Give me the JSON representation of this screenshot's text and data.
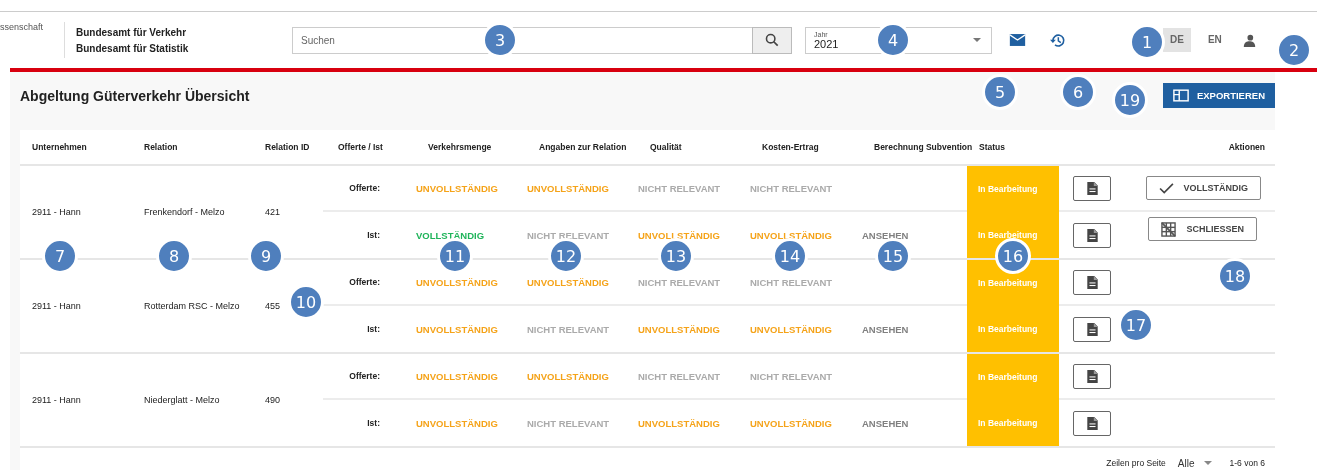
{
  "header": {
    "logo_fragment": "ssenschaft",
    "org_lines": [
      "Bundesamt für Verkehr",
      "Bundesamt für Statistik"
    ],
    "search": {
      "placeholder": "Suchen"
    },
    "year": {
      "label": "Jahr",
      "value": "2021"
    },
    "languages": [
      {
        "label": "DE",
        "selected": true
      },
      {
        "label": "EN",
        "selected": false
      }
    ]
  },
  "title": "Abgeltung Güterverkehr Übersicht",
  "export_button": "EXPORTIEREN",
  "table": {
    "columns": [
      "Unternehmen",
      "Relation",
      "Relation ID",
      "Offerte / Ist",
      "Verkehrsmenge",
      "Angaben zur Relation",
      "Qualität",
      "Kosten-Ertrag",
      "Berechnung Subvention",
      "Status",
      "Aktionen"
    ],
    "groups": [
      {
        "company": "2911 - Hann",
        "relation": "Frenkendorf - Melzo",
        "relation_id": "421",
        "entries": [
          {
            "label": "Offerte:",
            "verkehrsmenge": {
              "text": "UNVOLLSTÄNDIG",
              "kind": "incomplete"
            },
            "angaben": {
              "text": "UNVOLLSTÄNDIG",
              "kind": "incomplete"
            },
            "qualitaet": {
              "text": "NICHT RELEVANT",
              "kind": "irrelevant"
            },
            "kosten": {
              "text": "NICHT RELEVANT",
              "kind": "irrelevant"
            },
            "status": {
              "text": "In Bearbeitung",
              "kind": "pending"
            },
            "action": {
              "kind": "complete",
              "label": "VOLLSTÄNDIG"
            }
          },
          {
            "label": "Ist:",
            "verkehrsmenge": {
              "text": "VOLLSTÄNDIG",
              "kind": "complete"
            },
            "angaben": {
              "text": "NICHT RELEVANT",
              "kind": "irrelevant"
            },
            "qualitaet": {
              "text": "UNVOLLSTÄNDIG",
              "kind": "incomplete"
            },
            "kosten": {
              "text": "UNVOLLSTÄNDIG",
              "kind": "incomplete"
            },
            "berechnung": {
              "text": "ANSEHEN",
              "kind": "view"
            },
            "status": {
              "text": "In Bearbeitung",
              "kind": "pending"
            },
            "action": {
              "kind": "close",
              "label": "SCHLIESSEN"
            }
          }
        ]
      },
      {
        "company": "2911 - Hann",
        "relation": "Rotterdam RSC - Melzo",
        "relation_id": "455",
        "entries": [
          {
            "label": "Offerte:",
            "verkehrsmenge": {
              "text": "UNVOLLSTÄNDIG",
              "kind": "incomplete"
            },
            "angaben": {
              "text": "UNVOLLSTÄNDIG",
              "kind": "incomplete"
            },
            "qualitaet": {
              "text": "NICHT RELEVANT",
              "kind": "irrelevant"
            },
            "kosten": {
              "text": "NICHT RELEVANT",
              "kind": "irrelevant"
            },
            "status": {
              "text": "In Bearbeitung",
              "kind": "pending"
            }
          },
          {
            "label": "Ist:",
            "verkehrsmenge": {
              "text": "UNVOLLSTÄNDIG",
              "kind": "incomplete"
            },
            "angaben": {
              "text": "NICHT RELEVANT",
              "kind": "irrelevant"
            },
            "qualitaet": {
              "text": "UNVOLLSTÄNDIG",
              "kind": "incomplete"
            },
            "kosten": {
              "text": "UNVOLLSTÄNDIG",
              "kind": "incomplete"
            },
            "berechnung": {
              "text": "ANSEHEN",
              "kind": "view"
            },
            "status": {
              "text": "In Bearbeitung",
              "kind": "pending"
            }
          }
        ]
      },
      {
        "company": "2911 - Hann",
        "relation": "Niederglatt - Melzo",
        "relation_id": "490",
        "entries": [
          {
            "label": "Offerte:",
            "verkehrsmenge": {
              "text": "UNVOLLSTÄNDIG",
              "kind": "incomplete"
            },
            "angaben": {
              "text": "UNVOLLSTÄNDIG",
              "kind": "incomplete"
            },
            "qualitaet": {
              "text": "NICHT RELEVANT",
              "kind": "irrelevant"
            },
            "kosten": {
              "text": "NICHT RELEVANT",
              "kind": "irrelevant"
            },
            "status": {
              "text": "In Bearbeitung",
              "kind": "pending"
            }
          },
          {
            "label": "Ist:",
            "verkehrsmenge": {
              "text": "UNVOLLSTÄNDIG",
              "kind": "incomplete"
            },
            "angaben": {
              "text": "NICHT RELEVANT",
              "kind": "irrelevant"
            },
            "qualitaet": {
              "text": "UNVOLLSTÄNDIG",
              "kind": "incomplete"
            },
            "kosten": {
              "text": "UNVOLLSTÄNDIG",
              "kind": "incomplete"
            },
            "berechnung": {
              "text": "ANSEHEN",
              "kind": "view"
            },
            "status": {
              "text": "In Bearbeitung",
              "kind": "pending"
            }
          }
        ]
      }
    ],
    "footer": {
      "rows_per_page_label": "Zeilen pro Seite",
      "rows_per_page": "Alle",
      "range": "1-6 von 6"
    }
  },
  "callouts": [
    {
      "number": "1"
    },
    {
      "number": "2"
    },
    {
      "number": "3"
    },
    {
      "number": "4"
    },
    {
      "number": "5"
    },
    {
      "number": "6"
    },
    {
      "number": "7"
    },
    {
      "number": "8"
    },
    {
      "number": "9"
    },
    {
      "number": "10"
    },
    {
      "number": "11"
    },
    {
      "number": "12"
    },
    {
      "number": "13"
    },
    {
      "number": "14"
    },
    {
      "number": "15"
    },
    {
      "number": "16"
    },
    {
      "number": "17"
    },
    {
      "number": "18"
    },
    {
      "number": "19"
    }
  ]
}
